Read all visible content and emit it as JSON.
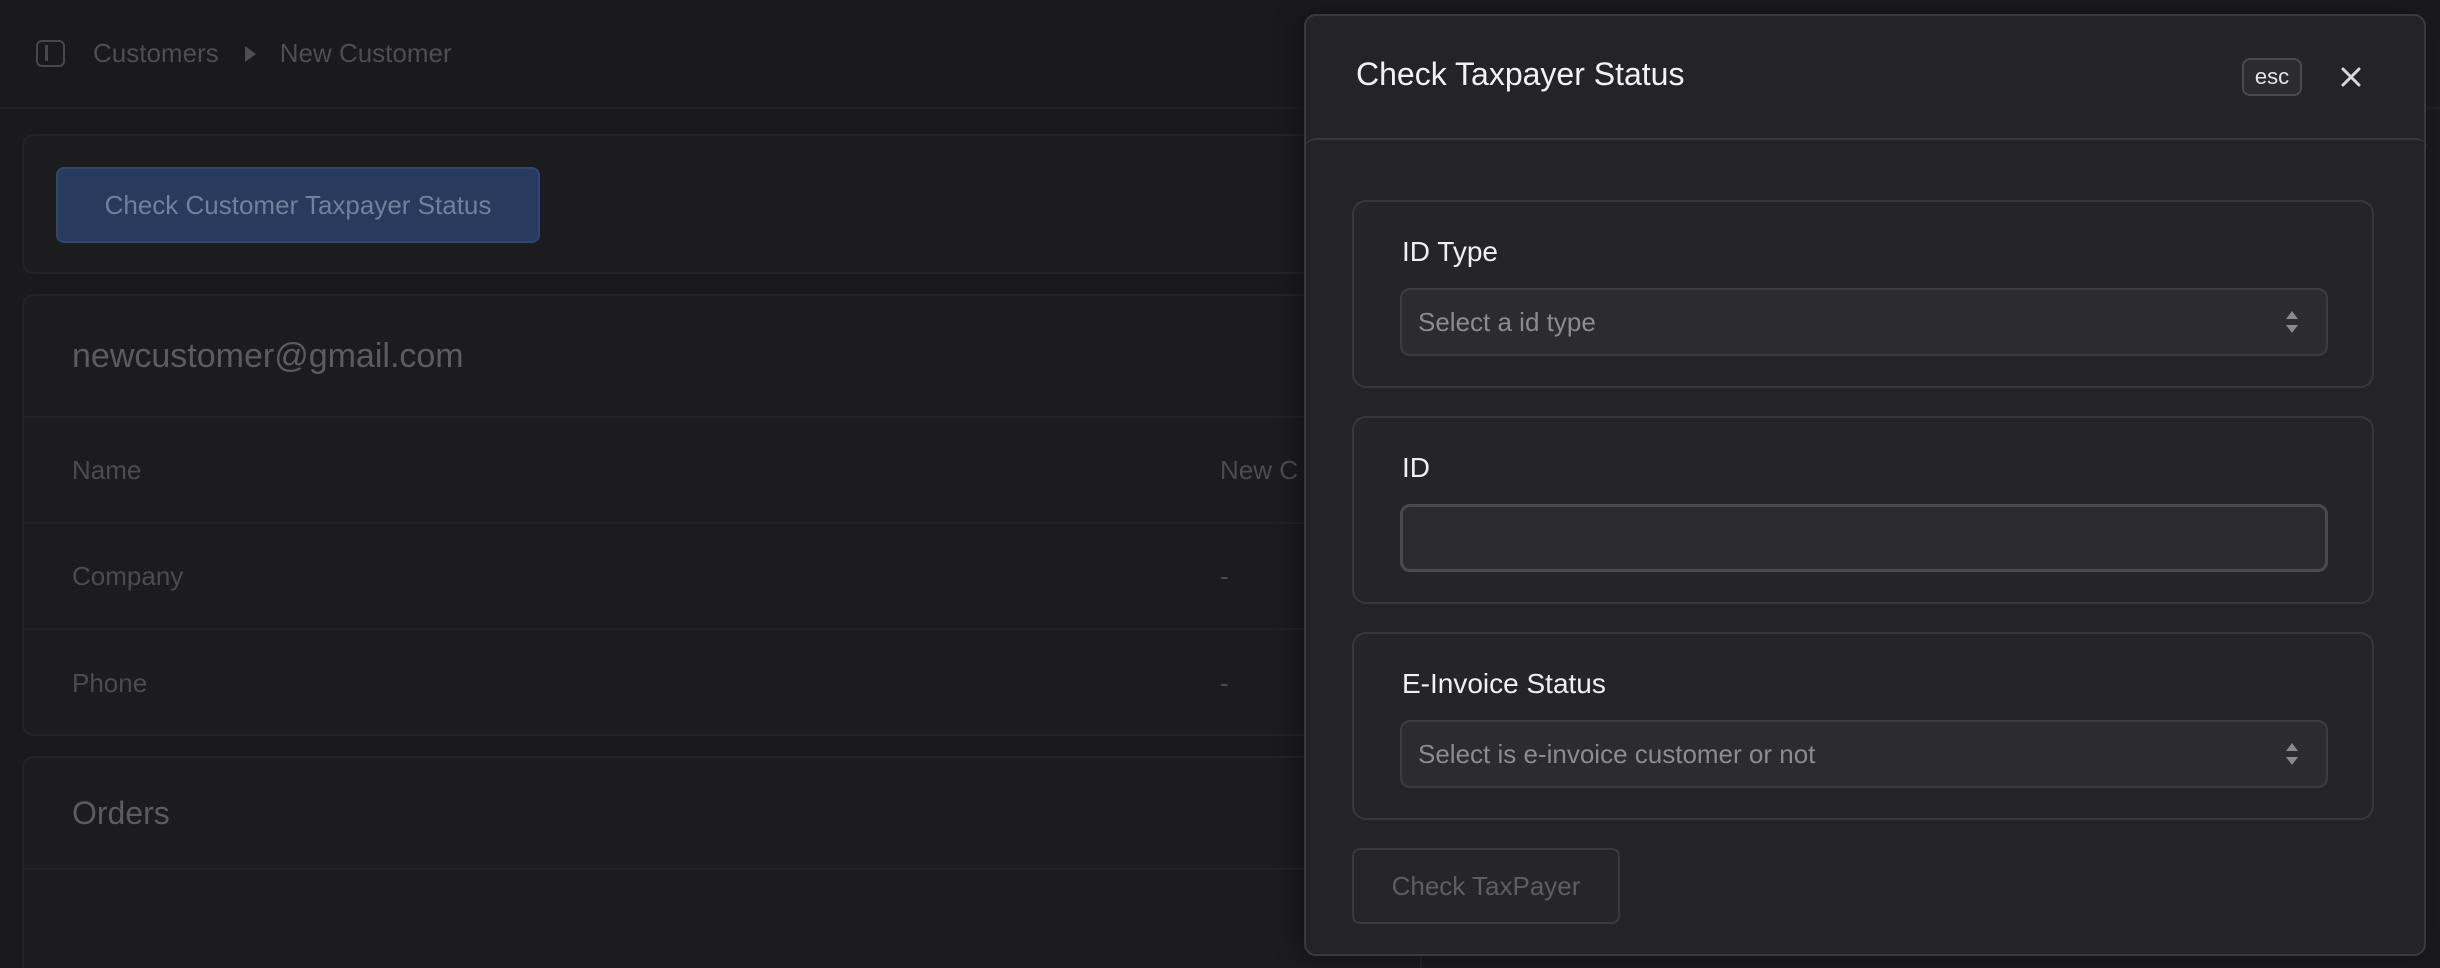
{
  "breadcrumb": {
    "items": [
      "Customers",
      "New Customer"
    ]
  },
  "actions": {
    "check_status_label": "Check Customer Taxpayer Status"
  },
  "customer": {
    "email": "newcustomer@gmail.com",
    "fields": [
      {
        "label": "Name",
        "value": "New C"
      },
      {
        "label": "Company",
        "value": "-"
      },
      {
        "label": "Phone",
        "value": "-"
      }
    ]
  },
  "orders": {
    "title": "Orders"
  },
  "modal": {
    "title": "Check Taxpayer Status",
    "esc_label": "esc",
    "id_type": {
      "label": "ID Type",
      "placeholder": "Select a id type"
    },
    "id": {
      "label": "ID",
      "value": ""
    },
    "einvoice": {
      "label": "E-Invoice Status",
      "placeholder": "Select is e-invoice customer or not"
    },
    "submit_label": "Check TaxPayer"
  },
  "colors": {
    "background": "#1a1a1c",
    "modal_bg": "#242426",
    "primary_dim": "#283a5e",
    "text": "#f0f0f2",
    "placeholder": "#8c8c90"
  }
}
